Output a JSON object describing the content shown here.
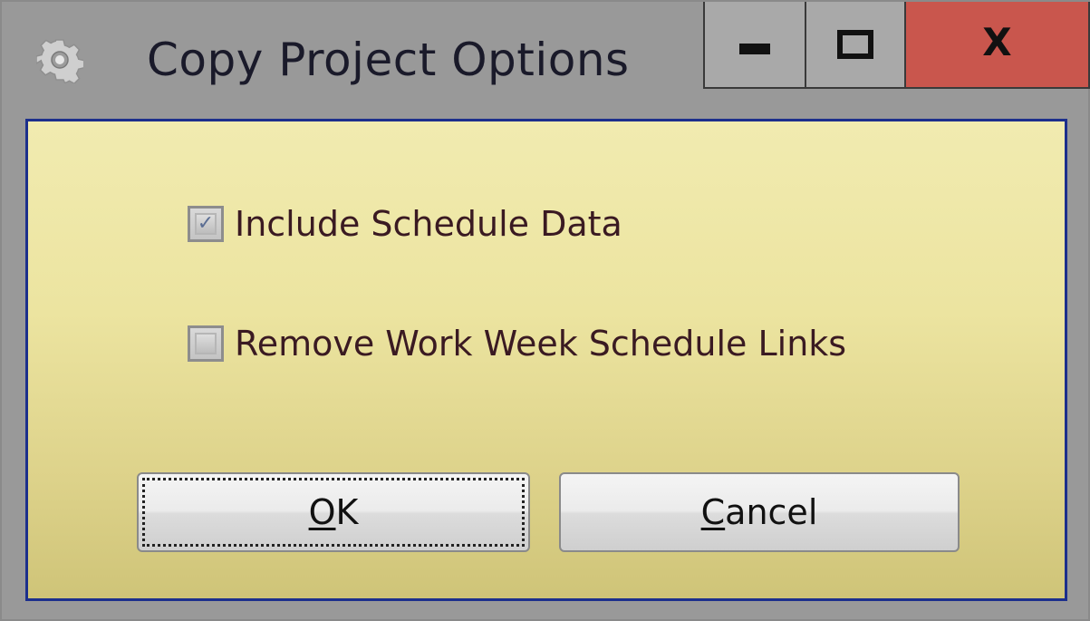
{
  "window": {
    "title": "Copy Project Options",
    "icon": "gear-icon",
    "controls": {
      "minimize_icon": "minimize-icon",
      "maximize_icon": "maximize-icon",
      "close_label": "X",
      "close_color": "#c9564d"
    }
  },
  "options": [
    {
      "label": "Include Schedule Data",
      "checked": true
    },
    {
      "label": "Remove Work Week Schedule Links",
      "checked": false
    }
  ],
  "buttons": {
    "ok": {
      "mnemonic": "O",
      "rest": "K"
    },
    "cancel": {
      "mnemonic": "C",
      "rest": "ancel"
    }
  },
  "colors": {
    "client_border": "#1c2f8c",
    "client_gradient_top": "#f1ebb0",
    "client_gradient_bottom": "#cfc478",
    "titlebar": "#999999"
  }
}
